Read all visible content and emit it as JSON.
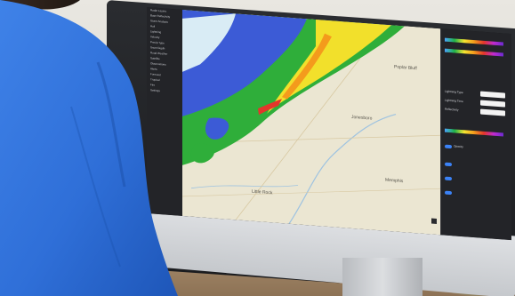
{
  "scene": {
    "left_panel_items": [
      "Radar Layers",
      "Base Reflectivity",
      "Storm Analysis",
      "Hail",
      "Lightning",
      "Velocity",
      "Precip Type",
      "Snow Depth",
      "Road Weather",
      "Satellite",
      "Observations",
      "Alerts",
      "Forecast",
      "Tropical",
      "Fire",
      "Settings"
    ],
    "right_panel": {
      "lightning_type_label": "Lightning Type",
      "lightning_time_label": "Lightning Time",
      "reflectivity_label": "Reflectivity",
      "opacity_label": "Opacity",
      "field_values": [
        "",
        "",
        ""
      ]
    },
    "map_labels": {
      "city_1": "Jonesboro",
      "city_2": "Memphis",
      "city_3": "Little Rock",
      "city_4": "Poplar Bluff"
    },
    "colors": {
      "radar_green": "#2fae3a",
      "radar_yellow": "#f2e02b",
      "radar_red": "#e3362b",
      "radar_blue": "#2a4fd0",
      "shirt_blue": "#2f6fd8",
      "accent_blue": "#3b82f6"
    }
  }
}
